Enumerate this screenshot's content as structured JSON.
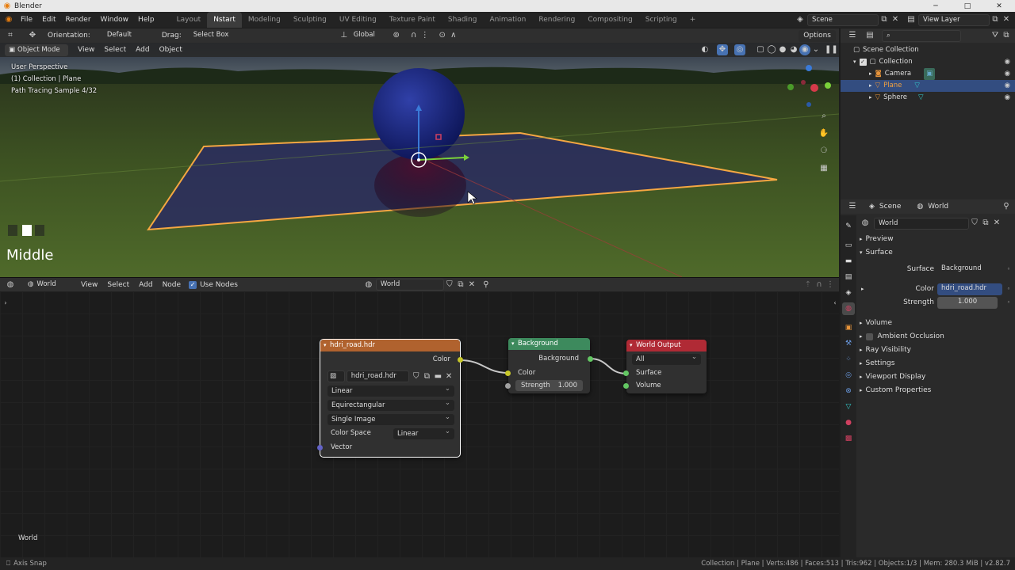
{
  "titlebar": {
    "app_title": "Blender",
    "minimize": "─",
    "maximize": "□",
    "close": "✕"
  },
  "menubar": {
    "menus": [
      "File",
      "Edit",
      "Render",
      "Window",
      "Help"
    ],
    "workspaces": [
      "Layout",
      "Nstart",
      "Modeling",
      "Sculpting",
      "UV Editing",
      "Texture Paint",
      "Shading",
      "Animation",
      "Rendering",
      "Compositing",
      "Scripting"
    ],
    "add_workspace": "+",
    "scene": "Scene",
    "view_layer": "View Layer"
  },
  "viewport_header": {
    "orientation_label": "Orientation:",
    "orientation_value": "Default",
    "drag_label": "Drag:",
    "drag_value": "Select Box",
    "transform_orientation": "Global",
    "options_label": "Options"
  },
  "viewport_header2": {
    "mode": "Object Mode",
    "menus": [
      "View",
      "Select",
      "Add",
      "Object"
    ]
  },
  "viewport": {
    "overlay_lines": [
      "User Perspective",
      "(1) Collection | Plane",
      "Path Tracing Sample 4/32"
    ],
    "big_text": "Middle"
  },
  "node_header": {
    "editor_type": "World",
    "menus": [
      "View",
      "Select",
      "Add",
      "Node"
    ],
    "use_nodes_label": "Use Nodes",
    "use_nodes_checked": true,
    "world_name": "World"
  },
  "nodes": {
    "image": {
      "title": "hdri_road.hdr",
      "output_color": "Color",
      "image_name": "hdri_road.hdr",
      "interpolation": "Linear",
      "projection": "Equirectangular",
      "source": "Single Image",
      "color_space_label": "Color Space",
      "color_space": "Linear",
      "input_vector": "Vector",
      "header_color": "#b0622e"
    },
    "background": {
      "title": "Background",
      "output": "Background",
      "input_color": "Color",
      "strength_label": "Strength",
      "strength_value": "1.000",
      "header_color": "#3d8a5d"
    },
    "world_output": {
      "title": "World Output",
      "target": "All",
      "input_surface": "Surface",
      "input_volume": "Volume",
      "header_color": "#b02a35"
    }
  },
  "node_editor_footer": "World",
  "outliner": {
    "root": "Scene Collection",
    "collection": "Collection",
    "items": [
      {
        "name": "Camera",
        "selected": false
      },
      {
        "name": "Plane",
        "selected": true
      },
      {
        "name": "Sphere",
        "selected": false
      }
    ]
  },
  "properties": {
    "breadcrumb_scene": "Scene",
    "breadcrumb_world": "World",
    "world_name": "World",
    "panels": {
      "preview": "Preview",
      "surface": "Surface"
    },
    "surface_label": "Surface",
    "surface_value": "Background",
    "color_label": "Color",
    "color_value": "hdri_road.hdr",
    "strength_label": "Strength",
    "strength_value": "1.000",
    "collapsed_panels": [
      "Volume",
      "Ambient Occlusion",
      "Ray Visibility",
      "Settings",
      "Viewport Display",
      "Custom Properties"
    ]
  },
  "statusbar": {
    "left": "Axis Snap",
    "right": "Collection | Plane | Verts:486 | Faces:513 | Tris:962 | Objects:1/3 | Mem: 280.3 MiB | v2.82.7"
  }
}
